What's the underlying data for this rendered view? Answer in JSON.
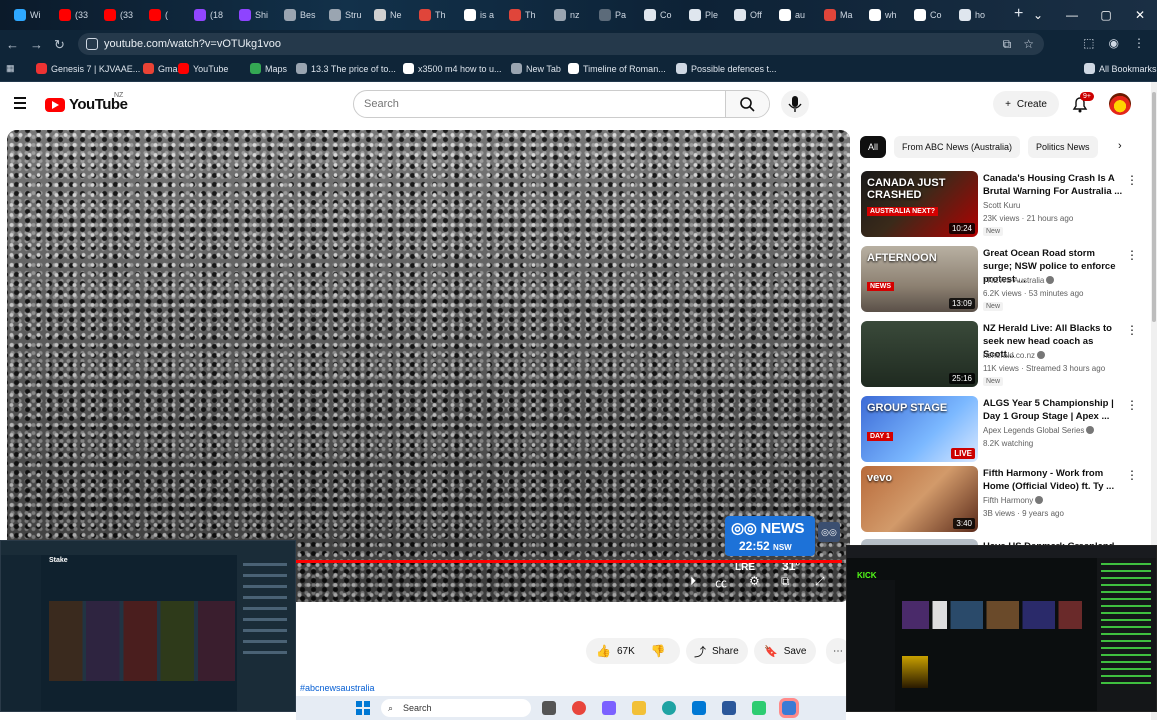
{
  "browser": {
    "tabs": [
      {
        "label": "Wi",
        "icon": "plus-icon",
        "color": "#2ea8ff"
      },
      {
        "label": "(33",
        "icon": "youtube-icon",
        "color": "#ff0000"
      },
      {
        "label": "(33",
        "icon": "youtube-icon",
        "color": "#ff0000"
      },
      {
        "label": "(",
        "icon": "youtube-icon",
        "color": "#ff0000"
      },
      {
        "label": "(18",
        "icon": "twitch-icon",
        "color": "#9146ff"
      },
      {
        "label": "Shi",
        "icon": "app-icon",
        "color": "#8e44ff"
      },
      {
        "label": "Bes",
        "icon": "page-icon",
        "color": "#9aa5b1"
      },
      {
        "label": "Stru",
        "icon": "globe-icon",
        "color": "#9aa5b1"
      },
      {
        "label": "Ne",
        "icon": "page-icon",
        "color": "#d0d0d0"
      },
      {
        "label": "Th",
        "icon": "app-icon",
        "color": "#e0453a"
      },
      {
        "label": "is a",
        "icon": "google-icon",
        "color": "#ffffff"
      },
      {
        "label": "Th",
        "icon": "app-icon",
        "color": "#e0453a"
      },
      {
        "label": "nz",
        "icon": "globe-icon",
        "color": "#9aa5b1"
      },
      {
        "label": "Pa",
        "icon": "page-icon",
        "color": "#5c6b7a"
      },
      {
        "label": "Co",
        "icon": "script-icon",
        "color": "#dfe6ee"
      },
      {
        "label": "Ple",
        "icon": "script-icon",
        "color": "#dfe6ee"
      },
      {
        "label": "Off",
        "icon": "script-icon",
        "color": "#dfe6ee"
      },
      {
        "label": "au",
        "icon": "google-icon",
        "color": "#ffffff"
      },
      {
        "label": "Ma",
        "icon": "app-icon",
        "color": "#e0453a"
      },
      {
        "label": "wh",
        "icon": "google-icon",
        "color": "#ffffff"
      },
      {
        "label": "Co",
        "icon": "wiki-icon",
        "color": "#ffffff"
      },
      {
        "label": "ho",
        "icon": "script-icon",
        "color": "#dfe6ee"
      }
    ],
    "url": "youtube.com/watch?v=vOTUkg1voo",
    "bookmarks": [
      {
        "label": "Genesis 7 | KJVAAE...",
        "color": "#e33"
      },
      {
        "label": "Gmail",
        "color": "#ea4335"
      },
      {
        "label": "YouTube",
        "color": "#ff0000"
      },
      {
        "label": "Maps",
        "color": "#34a853"
      },
      {
        "label": "13.3 The price of to...",
        "color": "#9aa5b1"
      },
      {
        "label": "x3500 m4 how to u...",
        "color": "#ffffff"
      },
      {
        "label": "New Tab",
        "color": "#9aa5b1"
      },
      {
        "label": "Timeline of Roman...",
        "color": "#ffffff"
      },
      {
        "label": "Possible defences t...",
        "color": "#cfd8e3"
      }
    ],
    "all_bookmarks": "All Bookmarks"
  },
  "youtube": {
    "region": "NZ",
    "search_placeholder": "Search",
    "create_label": "Create",
    "notif_badge": "9+",
    "video": {
      "channel_badge": "NEWS",
      "clock": "22:52",
      "timezone": "NSW",
      "live_label": "LRE",
      "temperature": "31°",
      "progress_fraction": 0.99
    },
    "likes": "67K",
    "share_label": "Share",
    "save_label": "Save",
    "hashtag": "#abcnewsaustralia",
    "chips": [
      "All",
      "From ABC News (Australia)",
      "Politics News"
    ],
    "recommendations": [
      {
        "title": "Canada's Housing Crash Is A Brutal Warning For Australia ...",
        "channel": "Scott Kuru",
        "meta": "23K views · 21 hours ago",
        "badge": "New",
        "duration": "10:24",
        "thumb_text": "CANADA JUST CRASHED",
        "thumb_sub": "AUSTRALIA NEXT?",
        "verified": false
      },
      {
        "title": "Great Ocean Road storm surge; NSW police to enforce protest ...",
        "channel": "7NEWS Australia",
        "meta": "6.2K views · 53 minutes ago",
        "badge": "New",
        "duration": "13:09",
        "thumb_text": "AFTERNOON",
        "thumb_sub": "NEWS",
        "verified": true
      },
      {
        "title": "NZ Herald Live: All Blacks to seek new head coach as Scott...",
        "channel": "nzherald.co.nz",
        "meta": "11K views · Streamed 3 hours ago",
        "badge": "New",
        "duration": "25:16",
        "thumb_text": "",
        "thumb_sub": "",
        "verified": true
      },
      {
        "title": "ALGS Year 5 Championship | Day 1 Group Stage | Apex ...",
        "channel": "Apex Legends Global Series",
        "meta": "8.2K watching",
        "badge": "",
        "duration": "LIVE",
        "thumb_text": "GROUP STAGE",
        "thumb_sub": "DAY 1",
        "verified": true
      },
      {
        "title": "Fifth Harmony - Work from Home (Official Video) ft. Ty ...",
        "channel": "Fifth Harmony",
        "meta": "3B views · 9 years ago",
        "badge": "",
        "duration": "3:40",
        "thumb_text": "vevo",
        "thumb_sub": "",
        "verified": true
      },
      {
        "title": "Have US Denmark Greenland ...",
        "channel": "",
        "meta": "",
        "badge": "",
        "duration": "",
        "thumb_text": "",
        "thumb_sub": "",
        "verified": false
      }
    ]
  },
  "overlays": {
    "left_logo": "Stake",
    "right_logo": "KICK"
  },
  "taskbar": {
    "search_label": "Search"
  },
  "colors": {
    "yt_red": "#ff0000",
    "abc_blue": "#1d72d8",
    "chrome_dark": "#0f2538"
  }
}
